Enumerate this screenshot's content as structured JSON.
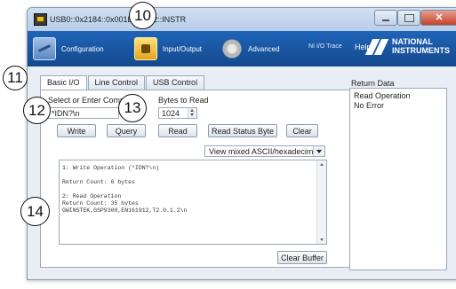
{
  "window": {
    "title": "USB0::0x2184::0x001B::...::12::INSTR"
  },
  "toolbar": {
    "items": [
      {
        "label": "Configuration",
        "icon": "configuration-icon"
      },
      {
        "label": "Input/Output",
        "icon": "input-output-icon"
      },
      {
        "label": "Advanced",
        "icon": "advanced-gear-icon"
      }
    ],
    "ni_io_trace": "NI I/O Trace",
    "help": "Help",
    "logo_line1": "NATIONAL",
    "logo_line2": "INSTRUMENTS"
  },
  "tabs": [
    {
      "label": "Basic I/O",
      "active": true
    },
    {
      "label": "Line Control",
      "active": false
    },
    {
      "label": "USB Control",
      "active": false
    }
  ],
  "basic_io": {
    "command_label": "Select or Enter Command",
    "command_value": "*IDN?\\n",
    "bytes_label": "Bytes to Read",
    "bytes_value": "1024",
    "buttons": {
      "write": "Write",
      "query": "Query",
      "read": "Read",
      "read_status_byte": "Read Status Byte",
      "clear": "Clear",
      "clear_buffer": "Clear Buffer"
    },
    "view_mode": "View mixed ASCII/hexadecimal",
    "output_lines": [
      "1: Write Operation (*IDN?\\n)",
      "",
      "Return Count: 6 bytes",
      "",
      "2: Read Operation",
      "Return Count: 35 bytes",
      "GWINSTEK,GSP9300,EN161912,T2.0.1.2\\n"
    ]
  },
  "return_data": {
    "title": "Return Data",
    "lines": [
      "Read Operation",
      "No Error"
    ]
  },
  "callouts": [
    "10",
    "11",
    "12",
    "13",
    "14"
  ],
  "colors": {
    "toolbar": "#1a56a6",
    "window_bg": "#e9eef5",
    "close_button": "#c4402b"
  }
}
